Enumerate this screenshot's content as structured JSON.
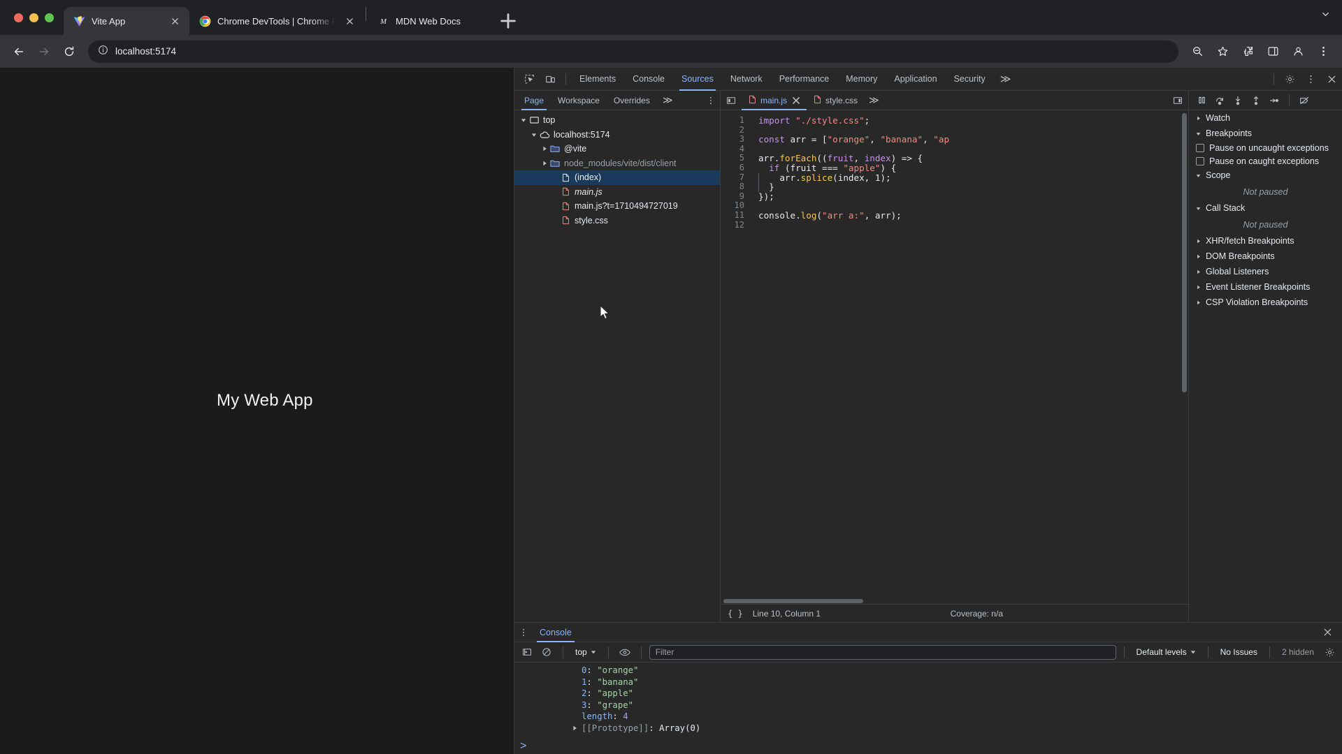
{
  "browser": {
    "tabs": [
      {
        "title": "Vite App",
        "favicon": "vite-logo-icon",
        "active": true,
        "closable": true
      },
      {
        "title": "Chrome DevTools | Chrome F",
        "favicon": "chrome-logo-icon",
        "active": false,
        "closable": true
      },
      {
        "title": "MDN Web Docs",
        "favicon": "mdn-logo-icon",
        "active": false,
        "closable": false
      }
    ],
    "new_tab_label": "+",
    "nav": {
      "back": "back-arrow-icon",
      "forward": "forward-arrow-icon",
      "reload": "reload-icon"
    },
    "omnibox": {
      "url": "localhost:5174",
      "site_info_icon": "info-circle-icon"
    },
    "toolbar_right": [
      "zoom-search-icon",
      "bookmark-star-icon",
      "extensions-icon",
      "devtools-panel-icon",
      "profile-avatar-icon",
      "chrome-menu-icon"
    ]
  },
  "page": {
    "heading": "My Web App"
  },
  "devtools": {
    "left_icons": [
      "inspect-element-icon",
      "device-toolbar-icon"
    ],
    "panels": [
      "Elements",
      "Console",
      "Sources",
      "Network",
      "Performance",
      "Memory",
      "Application",
      "Security"
    ],
    "active_panel": "Sources",
    "overflow_label": "≫",
    "right_icons": [
      "settings-gear-icon",
      "devtools-more-icon",
      "close-devtools-icon"
    ],
    "navigator": {
      "tabs": [
        "Page",
        "Workspace",
        "Overrides"
      ],
      "active_tab": "Page",
      "overflow_label": "≫",
      "tree": [
        {
          "label": "top",
          "icon": "frame-icon",
          "indent": 0,
          "twisty": "open",
          "state": "normal"
        },
        {
          "label": "localhost:5174",
          "icon": "cloud-icon",
          "indent": 1,
          "twisty": "open",
          "state": "normal"
        },
        {
          "label": "@vite",
          "icon": "folder-icon",
          "indent": 2,
          "twisty": "closed",
          "state": "normal"
        },
        {
          "label": "node_modules/vite/dist/client",
          "icon": "folder-icon",
          "indent": 2,
          "twisty": "closed",
          "state": "dim"
        },
        {
          "label": "(index)",
          "icon": "document-icon",
          "indent": 3,
          "twisty": "none",
          "state": "selected"
        },
        {
          "label": "main.js",
          "icon": "js-file-icon",
          "indent": 3,
          "twisty": "none",
          "state": "italic"
        },
        {
          "label": "main.js?t=1710494727019",
          "icon": "js-file-icon",
          "indent": 3,
          "twisty": "none",
          "state": "normal"
        },
        {
          "label": "style.css",
          "icon": "css-file-icon",
          "indent": 3,
          "twisty": "none",
          "state": "normal"
        }
      ]
    },
    "editor": {
      "sidebar_toggle_icon": "show-navigator-icon",
      "tabs": [
        {
          "label": "main.js",
          "icon": "js-file-icon",
          "active": true,
          "closable": true
        },
        {
          "label": "style.css",
          "icon": "css-file-icon",
          "active": false,
          "closable": false
        }
      ],
      "overflow_label": "≫",
      "show_debugger_icon": "show-debugger-icon",
      "debug_controls": [
        "pause-script-icon",
        "step-over-icon",
        "step-into-icon",
        "step-out-icon",
        "step-icon",
        "deactivate-breakpoints-icon"
      ],
      "lines": [
        {
          "n": 1,
          "tokens": [
            {
              "t": "import",
              "c": "kw"
            },
            {
              "t": " ",
              "c": "pun"
            },
            {
              "t": "\"./style.css\"",
              "c": "str"
            },
            {
              "t": ";",
              "c": "pun"
            }
          ]
        },
        {
          "n": 2,
          "tokens": []
        },
        {
          "n": 3,
          "tokens": [
            {
              "t": "const",
              "c": "kw"
            },
            {
              "t": " arr = [",
              "c": "pun"
            },
            {
              "t": "\"orange\"",
              "c": "str"
            },
            {
              "t": ", ",
              "c": "pun"
            },
            {
              "t": "\"banana\"",
              "c": "str"
            },
            {
              "t": ", ",
              "c": "pun"
            },
            {
              "t": "\"ap",
              "c": "str"
            }
          ]
        },
        {
          "n": 4,
          "tokens": []
        },
        {
          "n": 5,
          "tokens": [
            {
              "t": "arr.",
              "c": "pun"
            },
            {
              "t": "forEach",
              "c": "fn"
            },
            {
              "t": "((",
              "c": "pun"
            },
            {
              "t": "fruit",
              "c": "par"
            },
            {
              "t": ", ",
              "c": "pun"
            },
            {
              "t": "index",
              "c": "par"
            },
            {
              "t": ") => {",
              "c": "pun"
            }
          ]
        },
        {
          "n": 6,
          "tokens": [
            {
              "t": "  ",
              "c": "pun"
            },
            {
              "t": "if",
              "c": "kw"
            },
            {
              "t": " (fruit === ",
              "c": "pun"
            },
            {
              "t": "\"apple\"",
              "c": "str"
            },
            {
              "t": ") {",
              "c": "pun"
            }
          ]
        },
        {
          "n": 7,
          "tokens": [
            {
              "t": "    arr.",
              "c": "pun"
            },
            {
              "t": "splice",
              "c": "fn"
            },
            {
              "t": "(index, ",
              "c": "pun"
            },
            {
              "t": "1",
              "c": "pun"
            },
            {
              "t": ");",
              "c": "pun"
            }
          ]
        },
        {
          "n": 8,
          "tokens": [
            {
              "t": "  }",
              "c": "pun"
            }
          ]
        },
        {
          "n": 9,
          "tokens": [
            {
              "t": "});",
              "c": "pun"
            }
          ]
        },
        {
          "n": 10,
          "tokens": []
        },
        {
          "n": 11,
          "tokens": [
            {
              "t": "console.",
              "c": "pun"
            },
            {
              "t": "log",
              "c": "fn"
            },
            {
              "t": "(",
              "c": "pun"
            },
            {
              "t": "\"arr a:\"",
              "c": "str"
            },
            {
              "t": ", arr);",
              "c": "pun"
            }
          ]
        },
        {
          "n": 12,
          "tokens": []
        }
      ],
      "status": {
        "pretty_print_icon": "{ }",
        "position": "Line 10, Column 1",
        "coverage": "Coverage: n/a"
      }
    },
    "debugger": {
      "sections": [
        {
          "label": "Watch",
          "expanded": false,
          "type": "section"
        },
        {
          "label": "Breakpoints",
          "expanded": true,
          "type": "section"
        },
        {
          "label": "Pause on uncaught exceptions",
          "type": "checkbox",
          "checked": false
        },
        {
          "label": "Pause on caught exceptions",
          "type": "checkbox",
          "checked": false
        },
        {
          "label": "Scope",
          "expanded": true,
          "type": "section"
        },
        {
          "label": "Not paused",
          "type": "empty"
        },
        {
          "label": "Call Stack",
          "expanded": true,
          "type": "section"
        },
        {
          "label": "Not paused",
          "type": "empty"
        },
        {
          "label": "XHR/fetch Breakpoints",
          "expanded": false,
          "type": "section"
        },
        {
          "label": "DOM Breakpoints",
          "expanded": false,
          "type": "section"
        },
        {
          "label": "Global Listeners",
          "expanded": false,
          "type": "section"
        },
        {
          "label": "Event Listener Breakpoints",
          "expanded": false,
          "type": "section"
        },
        {
          "label": "CSP Violation Breakpoints",
          "expanded": false,
          "type": "section"
        }
      ]
    },
    "drawer": {
      "kebab_icon": "drawer-more-icon",
      "tab": "Console",
      "close_icon": "close-drawer-icon",
      "toolbar": {
        "sidebar_icon": "console-sidebar-icon",
        "clear_icon": "clear-console-icon",
        "context": "top",
        "eye_icon": "live-expression-icon",
        "filter_placeholder": "Filter",
        "filter_value": "",
        "levels": "Default levels",
        "issues": "No Issues",
        "hidden": "2 hidden",
        "settings_icon": "console-settings-icon"
      },
      "output": [
        {
          "key": "0",
          "sep": ": ",
          "value": "\"orange\"",
          "kind": "string"
        },
        {
          "key": "1",
          "sep": ": ",
          "value": "\"banana\"",
          "kind": "string"
        },
        {
          "key": "2",
          "sep": ": ",
          "value": "\"apple\"",
          "kind": "string"
        },
        {
          "key": "3",
          "sep": ": ",
          "value": "\"grape\"",
          "kind": "string"
        },
        {
          "key": "length",
          "sep": ": ",
          "value": "4",
          "kind": "number"
        },
        {
          "key": "[[Prototype]]",
          "sep": ": ",
          "value": "Array(0)",
          "kind": "proto"
        }
      ],
      "prompt": ">"
    }
  },
  "colors": {
    "accent": "#8ab4f8",
    "bg_devtools": "#282828",
    "bg_page": "#1b1b1b",
    "bg_chrome": "#202124",
    "bg_toolbar": "#35363a",
    "selected_row": "#1a3a5c",
    "string_token": "#f28b82",
    "keyword_token": "#c792ea",
    "function_token": "#f8c555"
  }
}
